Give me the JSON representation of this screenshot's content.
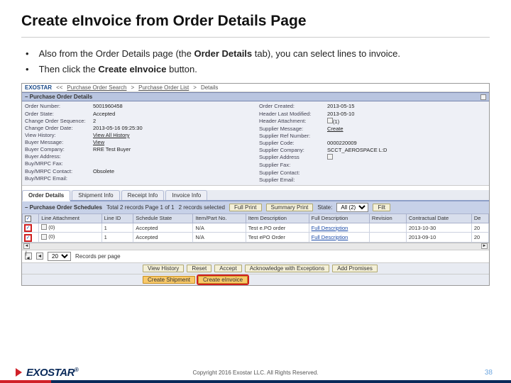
{
  "title": "Create eInvoice from Order Details Page",
  "bullets": [
    {
      "pre": "Also from the Order Details page (the ",
      "bold": "Order Details",
      "post": " tab), you can select lines to invoice."
    },
    {
      "pre": "Then click the ",
      "bold": "Create eInvoice",
      "post": " button."
    }
  ],
  "breadcrumb": {
    "logo": "EXOSTAR",
    "seg1": "<<",
    "seg2": "Purchase Order Search",
    "seg3": ">",
    "seg4": "Purchase Order List",
    "seg5": ">",
    "seg6": "Details"
  },
  "section_title": "– Purchase Order Details",
  "details_left": [
    {
      "lbl": "Order Number:",
      "val": "5001960458"
    },
    {
      "lbl": "Order State:",
      "val": "Accepted"
    },
    {
      "lbl": "Change Order Sequence:",
      "val": "2"
    },
    {
      "lbl": "Change Order Date:",
      "val": "2013-05-16 09:25:30"
    },
    {
      "lbl": "View History:",
      "val": "View All History",
      "link": true
    },
    {
      "lbl": "Buyer Message:",
      "val": "View",
      "link": true
    },
    {
      "lbl": "Buyer Company:",
      "val": "RRE Test Buyer"
    },
    {
      "lbl": "Buyer Address:",
      "val": ""
    },
    {
      "lbl": "Buy/MRPC Fax:",
      "val": ""
    },
    {
      "lbl": "Buy/MRPC Contact:",
      "val": "Obsolete"
    },
    {
      "lbl": "Buy/MRPC Email:",
      "val": ""
    }
  ],
  "details_right": [
    {
      "lbl": "Order Created:",
      "val": "2013-05-15"
    },
    {
      "lbl": "Header Last Modified:",
      "val": "2013-05-10"
    },
    {
      "lbl": "Header Attachment:",
      "val": "(1)",
      "icon": true
    },
    {
      "lbl": "Supplier Message:",
      "val": "Create",
      "link": true
    },
    {
      "lbl": "Supplier Ref Number:",
      "val": ""
    },
    {
      "lbl": "Supplier Code:",
      "val": "0000220009"
    },
    {
      "lbl": "Supplier Company:",
      "val": "SCCT_AEROSPACE L:D"
    },
    {
      "lbl": "Supplier Address",
      "val": "",
      "icon": true
    },
    {
      "lbl": "Supplier Fax:",
      "val": ""
    },
    {
      "lbl": "Supplier Contact:",
      "val": ""
    },
    {
      "lbl": "Supplier Email:",
      "val": ""
    }
  ],
  "tab_labels": [
    "Order Details",
    "Shipment Info",
    "Receipt Info",
    "Invoice Info"
  ],
  "sched_bar": {
    "title": "– Purchase Order Schedules",
    "total": "Total 2 records Page 1 of 1",
    "selected": "2 records selected",
    "full_print": "Full Print",
    "summary_print": "Summary Print",
    "state_lbl": "State:",
    "state_val": "All (2)",
    "filter": "Filt"
  },
  "grid_headers": [
    "",
    "Line Attachment",
    "Line ID",
    "Schedule State",
    "Item/Part No.",
    "Item Description",
    "Full Description",
    "Revision",
    "Contractual Date",
    "De"
  ],
  "grid_rows": [
    {
      "att": "(0)",
      "line": "1",
      "state": "Accepted",
      "item": "N/A",
      "desc": "Test e.PO order",
      "full": "Full Description",
      "rev": "",
      "date": "2013-10-30",
      "de": "20"
    },
    {
      "att": "(0)",
      "line": "1",
      "state": "Accepted",
      "item": "N/A",
      "desc": "Test ePO Order",
      "full": "Full Description",
      "rev": "",
      "date": "2013-09-10",
      "de": "20"
    }
  ],
  "pager": {
    "size": "20",
    "label": "Records per page"
  },
  "actions_row1": [
    "View History",
    "Reset",
    "Accept",
    "Acknowledge with Exceptions",
    "Add Promises"
  ],
  "actions_row2": [
    "Create Shipment",
    "Create eInvoice"
  ],
  "footer": {
    "logo": "EXOSTAR",
    "copy": "Copyright 2016 Exostar LLC. All Rights Reserved.",
    "page": "38"
  }
}
